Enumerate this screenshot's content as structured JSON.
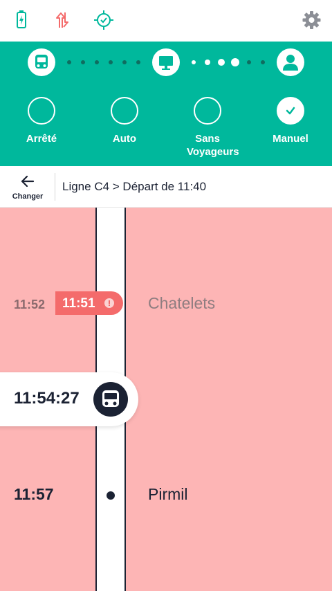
{
  "colors": {
    "accent": "#00b89c",
    "late": "#f46b6b",
    "timeline_bg": "#fdb5b5",
    "dark": "#1b2233"
  },
  "status_bar": {
    "icons": [
      "battery-charging-icon",
      "sync-arrows-icon",
      "gps-locate-icon",
      "settings-gear-icon"
    ]
  },
  "progress": {
    "steps": [
      "bus-icon",
      "monitor-icon",
      "user-icon"
    ]
  },
  "modes": [
    {
      "label": "Arrêté",
      "selected": false
    },
    {
      "label": "Auto",
      "selected": false
    },
    {
      "label": "Sans Voyageurs",
      "selected": false
    },
    {
      "label": "Manuel",
      "selected": true
    }
  ],
  "header": {
    "back_label": "Changer",
    "title": "Ligne C4 > Départ de 11:40"
  },
  "timeline": {
    "past_stop": {
      "scheduled_time": "11:52",
      "actual_time": "11:51",
      "name": "Chatelets"
    },
    "current": {
      "time": "11:54:27"
    },
    "next_stop": {
      "time": "11:57",
      "name": "Pirmil"
    }
  }
}
